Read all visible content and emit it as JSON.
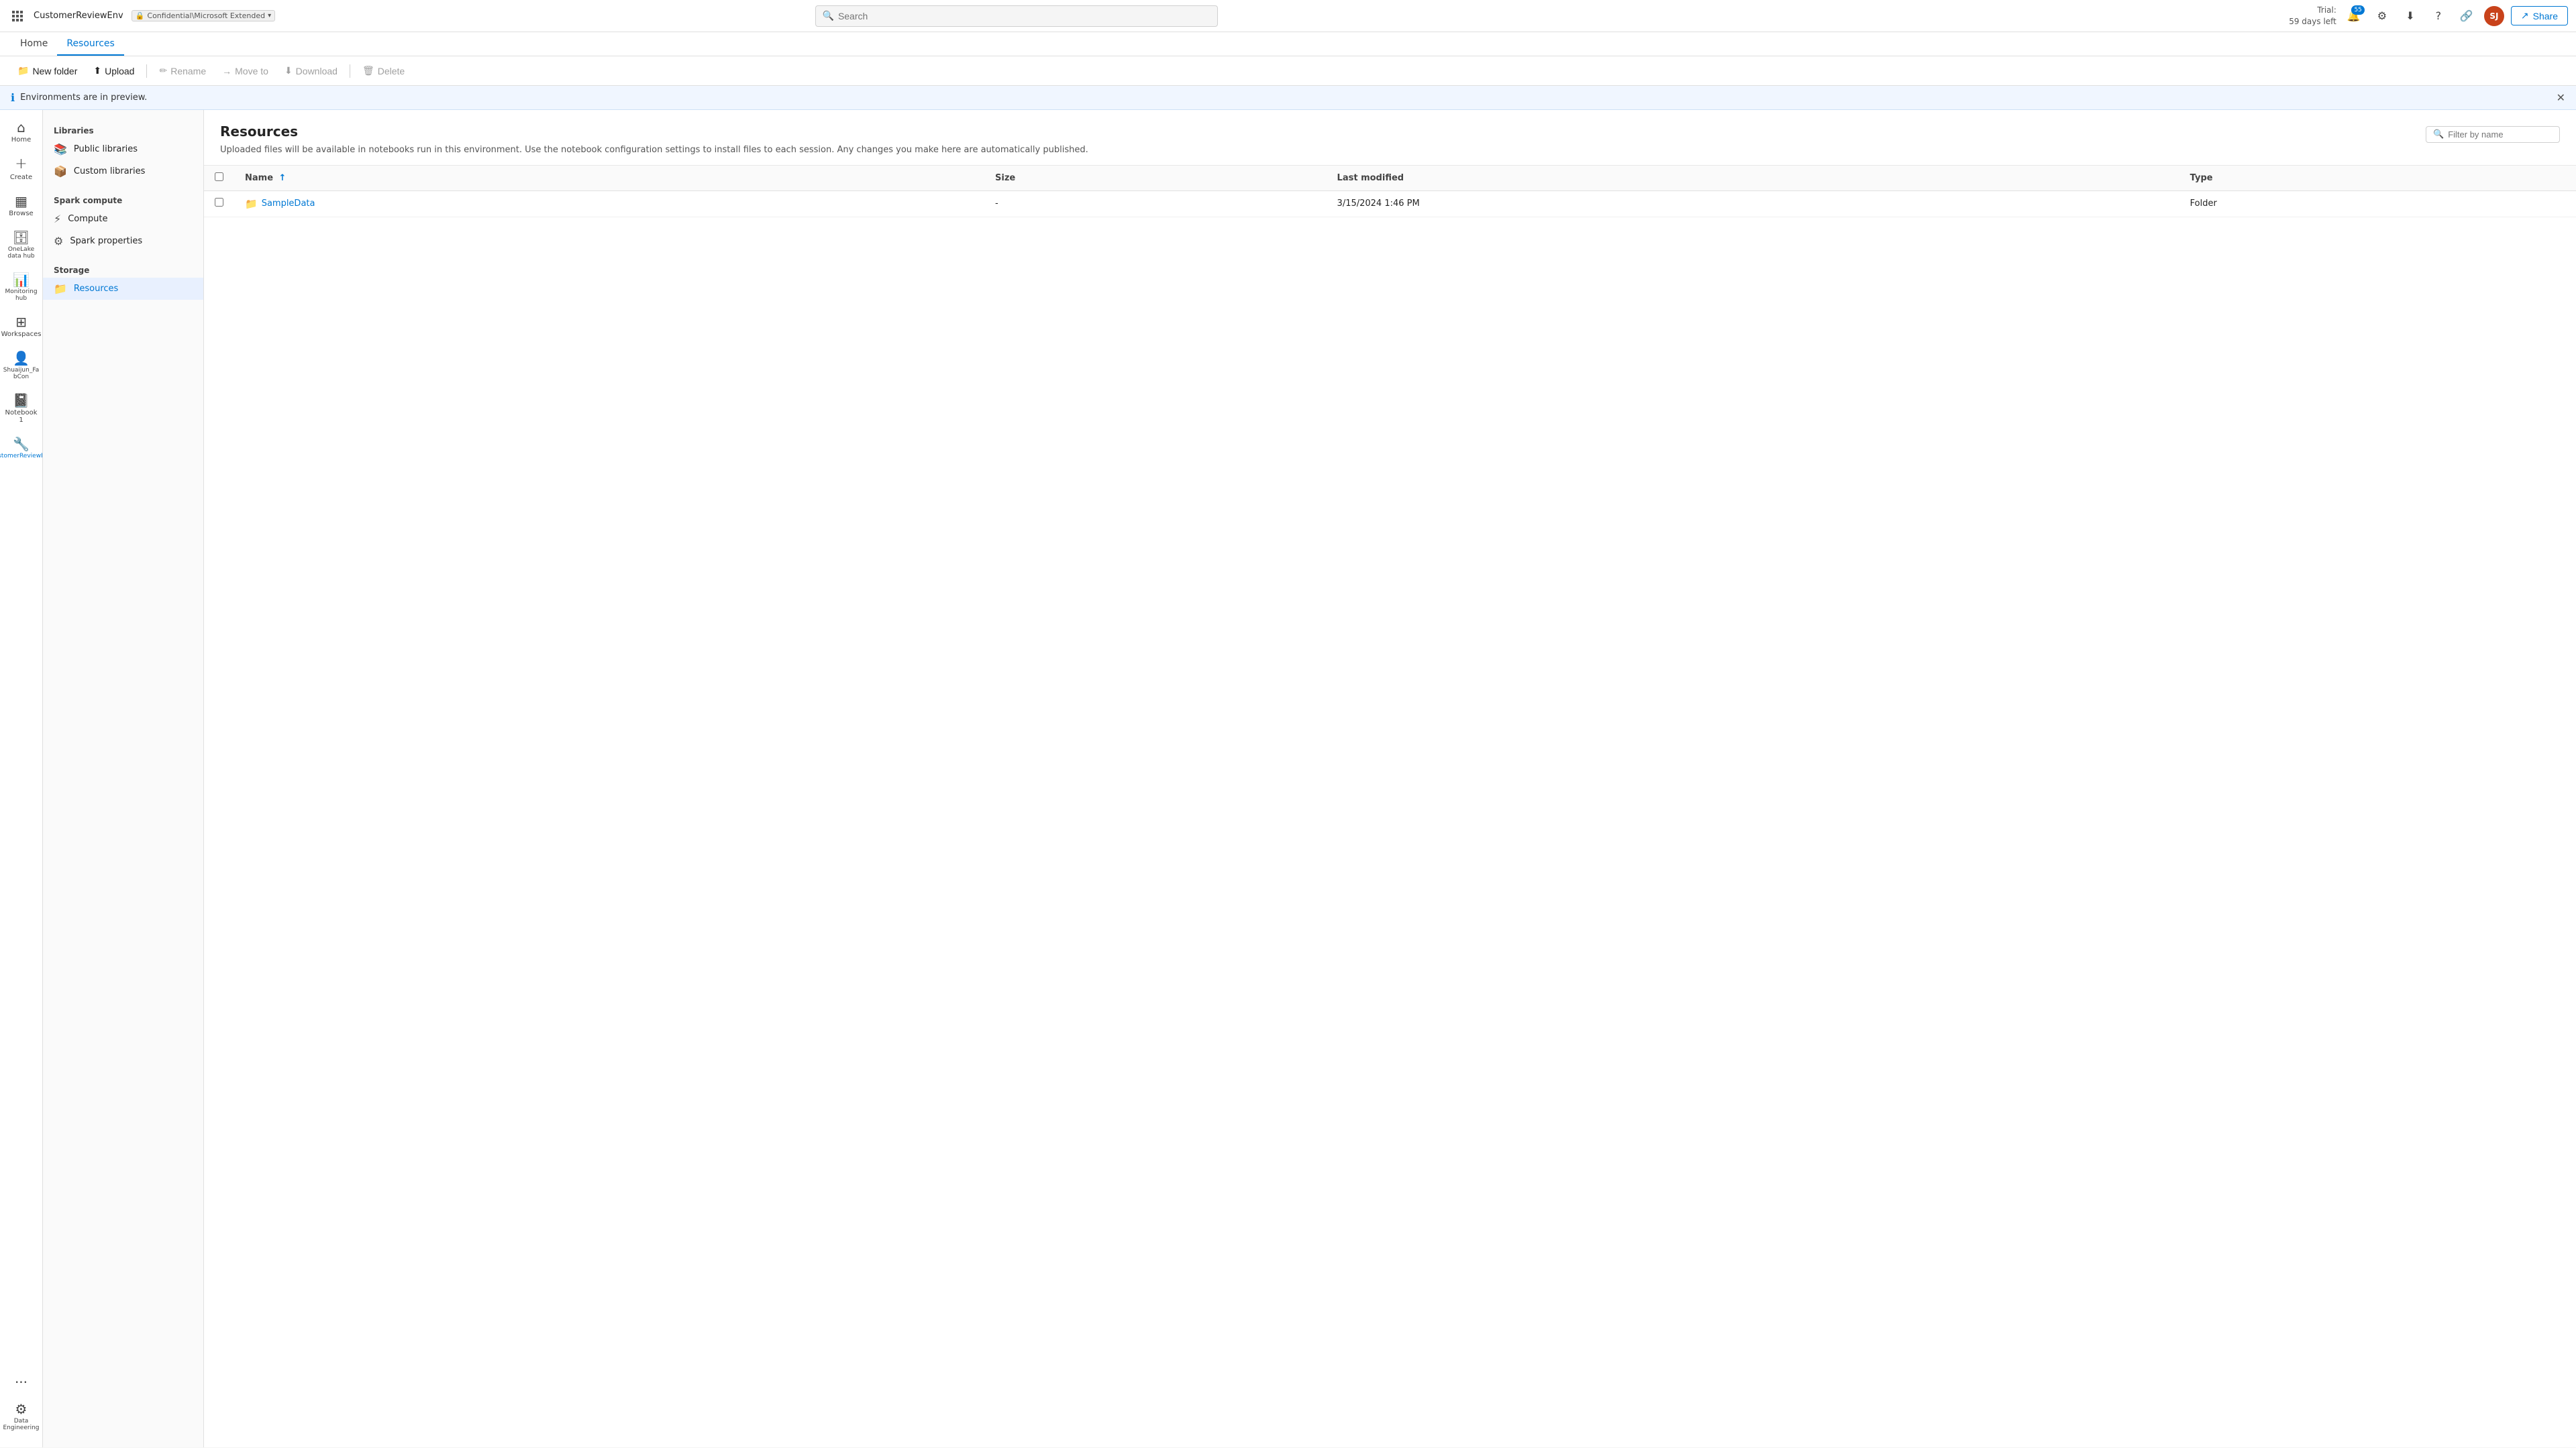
{
  "topNav": {
    "waffle_icon": "⊞",
    "env_name": "CustomerReviewEnv",
    "badge_label": "Confidential\\Microsoft Extended",
    "badge_chevron": "▾",
    "search_placeholder": "Search",
    "trial_line1": "Trial:",
    "trial_line2": "59 days left",
    "notification_count": "55",
    "share_label": "Share",
    "avatar_initials": "SJ"
  },
  "tabs": [
    {
      "id": "home",
      "label": "Home"
    },
    {
      "id": "resources",
      "label": "Resources",
      "active": true
    }
  ],
  "toolbar": {
    "new_folder_label": "New folder",
    "upload_label": "Upload",
    "rename_label": "Rename",
    "move_to_label": "Move to",
    "download_label": "Download",
    "delete_label": "Delete"
  },
  "previewBanner": {
    "message": "Environments are in preview."
  },
  "iconSidebar": [
    {
      "id": "home",
      "icon": "⌂",
      "label": "Home"
    },
    {
      "id": "create",
      "icon": "+",
      "label": "Create"
    },
    {
      "id": "browse",
      "icon": "⬚",
      "label": "Browse"
    },
    {
      "id": "onelake",
      "icon": "☁",
      "label": "OneLake data hub"
    },
    {
      "id": "monitoring",
      "icon": "📊",
      "label": "Monitoring hub"
    },
    {
      "id": "workspaces",
      "icon": "⊞",
      "label": "Workspaces"
    },
    {
      "id": "shuaijun",
      "icon": "👤",
      "label": "Shuaijun_Fa bCon"
    },
    {
      "id": "notebook1",
      "icon": "📓",
      "label": "Notebook 1"
    },
    {
      "id": "customerreviewenv",
      "icon": "🔧",
      "label": "CustomerReviewEnv",
      "active": true
    },
    {
      "id": "more",
      "icon": "···",
      "label": ""
    },
    {
      "id": "data-engineering",
      "icon": "⚙",
      "label": "Data Engineering"
    }
  ],
  "navPanel": {
    "libraries_title": "Libraries",
    "items_libraries": [
      {
        "id": "public-libraries",
        "icon": "📚",
        "label": "Public libraries"
      },
      {
        "id": "custom-libraries",
        "icon": "📦",
        "label": "Custom libraries"
      }
    ],
    "spark_compute_title": "Spark compute",
    "items_spark": [
      {
        "id": "compute",
        "icon": "⚡",
        "label": "Compute"
      },
      {
        "id": "spark-properties",
        "icon": "⚙",
        "label": "Spark properties"
      }
    ],
    "storage_title": "Storage",
    "items_storage": [
      {
        "id": "resources",
        "icon": "📁",
        "label": "Resources",
        "active": true
      }
    ]
  },
  "content": {
    "title": "Resources",
    "description": "Uploaded files will be available in notebooks run in this environment. Use the notebook configuration settings to install files to each session. Any changes you make here are automatically published.",
    "filter_placeholder": "Filter by name",
    "table": {
      "columns": [
        {
          "id": "name",
          "label": "Name",
          "sortable": true,
          "sort_indicator": "↑"
        },
        {
          "id": "size",
          "label": "Size"
        },
        {
          "id": "last_modified",
          "label": "Last modified"
        },
        {
          "id": "type",
          "label": "Type"
        }
      ],
      "rows": [
        {
          "name": "SampleData",
          "size": "-",
          "last_modified": "3/15/2024 1:46 PM",
          "type": "Folder",
          "is_folder": true
        }
      ]
    }
  }
}
